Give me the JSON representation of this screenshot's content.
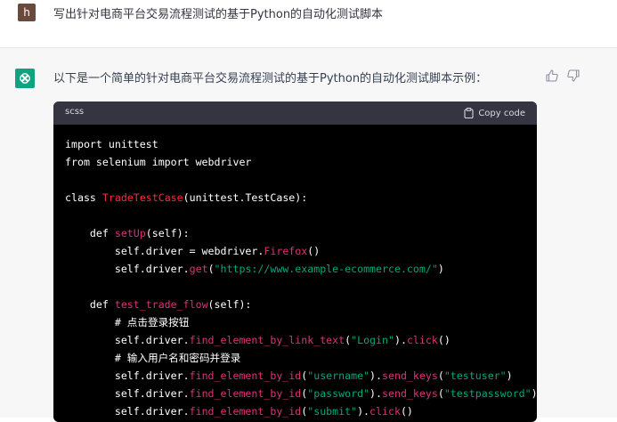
{
  "user": {
    "avatar_letter": "h",
    "message": "写出针对电商平台交易流程测试的基于Python的自动化测试脚本"
  },
  "assistant": {
    "avatar_icon": "openai-logo-icon",
    "intro": "以下是一个简单的针对电商平台交易流程测试的基于Python的自动化测试脚本示例：",
    "feedback_icons": [
      "thumbs-up-icon",
      "thumbs-down-icon"
    ]
  },
  "code_block": {
    "language": "scss",
    "copy_label": "Copy code",
    "copy_icon": "clipboard-icon",
    "lines": [
      [
        {
          "t": "import unittest",
          "c": "plain"
        }
      ],
      [
        {
          "t": "from selenium import webdriver",
          "c": "plain"
        }
      ],
      [],
      [
        {
          "t": "class ",
          "c": "kw"
        },
        {
          "t": "TradeTestCase",
          "c": "cls"
        },
        {
          "t": "(unittest.TestCase):",
          "c": "plain"
        }
      ],
      [],
      [
        {
          "t": "    def ",
          "c": "kw"
        },
        {
          "t": "setUp",
          "c": "fn"
        },
        {
          "t": "(self):",
          "c": "plain"
        }
      ],
      [
        {
          "t": "        self.driver = webdriver.",
          "c": "plain"
        },
        {
          "t": "Firefox",
          "c": "fn"
        },
        {
          "t": "()",
          "c": "plain"
        }
      ],
      [
        {
          "t": "        self.driver.",
          "c": "plain"
        },
        {
          "t": "get",
          "c": "fn"
        },
        {
          "t": "(",
          "c": "plain"
        },
        {
          "t": "\"https://www.example-ecommerce.com/\"",
          "c": "str"
        },
        {
          "t": ")",
          "c": "plain"
        }
      ],
      [],
      [
        {
          "t": "    def ",
          "c": "kw"
        },
        {
          "t": "test_trade_flow",
          "c": "fn"
        },
        {
          "t": "(self):",
          "c": "plain"
        }
      ],
      [
        {
          "t": "        # 点击登录按钮",
          "c": "comment"
        }
      ],
      [
        {
          "t": "        self.driver.",
          "c": "plain"
        },
        {
          "t": "find_element_by_link_text",
          "c": "fn"
        },
        {
          "t": "(",
          "c": "plain"
        },
        {
          "t": "\"Login\"",
          "c": "str"
        },
        {
          "t": ").",
          "c": "plain"
        },
        {
          "t": "click",
          "c": "fn"
        },
        {
          "t": "()",
          "c": "plain"
        }
      ],
      [
        {
          "t": "        # 输入用户名和密码并登录",
          "c": "comment"
        }
      ],
      [
        {
          "t": "        self.driver.",
          "c": "plain"
        },
        {
          "t": "find_element_by_id",
          "c": "fn"
        },
        {
          "t": "(",
          "c": "plain"
        },
        {
          "t": "\"username\"",
          "c": "str"
        },
        {
          "t": ").",
          "c": "plain"
        },
        {
          "t": "send_keys",
          "c": "fn"
        },
        {
          "t": "(",
          "c": "plain"
        },
        {
          "t": "\"testuser\"",
          "c": "str"
        },
        {
          "t": ")",
          "c": "plain"
        }
      ],
      [
        {
          "t": "        self.driver.",
          "c": "plain"
        },
        {
          "t": "find_element_by_id",
          "c": "fn"
        },
        {
          "t": "(",
          "c": "plain"
        },
        {
          "t": "\"password\"",
          "c": "str"
        },
        {
          "t": ").",
          "c": "plain"
        },
        {
          "t": "send_keys",
          "c": "fn"
        },
        {
          "t": "(",
          "c": "plain"
        },
        {
          "t": "\"testpassword\"",
          "c": "str"
        },
        {
          "t": ")",
          "c": "plain"
        }
      ],
      [
        {
          "t": "        self.driver.",
          "c": "plain"
        },
        {
          "t": "find_element_by_id",
          "c": "fn"
        },
        {
          "t": "(",
          "c": "plain"
        },
        {
          "t": "\"submit\"",
          "c": "str"
        },
        {
          "t": ").",
          "c": "plain"
        },
        {
          "t": "click",
          "c": "fn"
        },
        {
          "t": "()",
          "c": "plain"
        }
      ]
    ]
  },
  "colors": {
    "user_avatar": "#6b4a3e",
    "gpt_avatar": "#10a37f",
    "code_bg": "#000000",
    "code_header_bg": "#343541",
    "class_name": "#f22c3d",
    "function_name": "#df3079",
    "string": "#00a67d"
  }
}
